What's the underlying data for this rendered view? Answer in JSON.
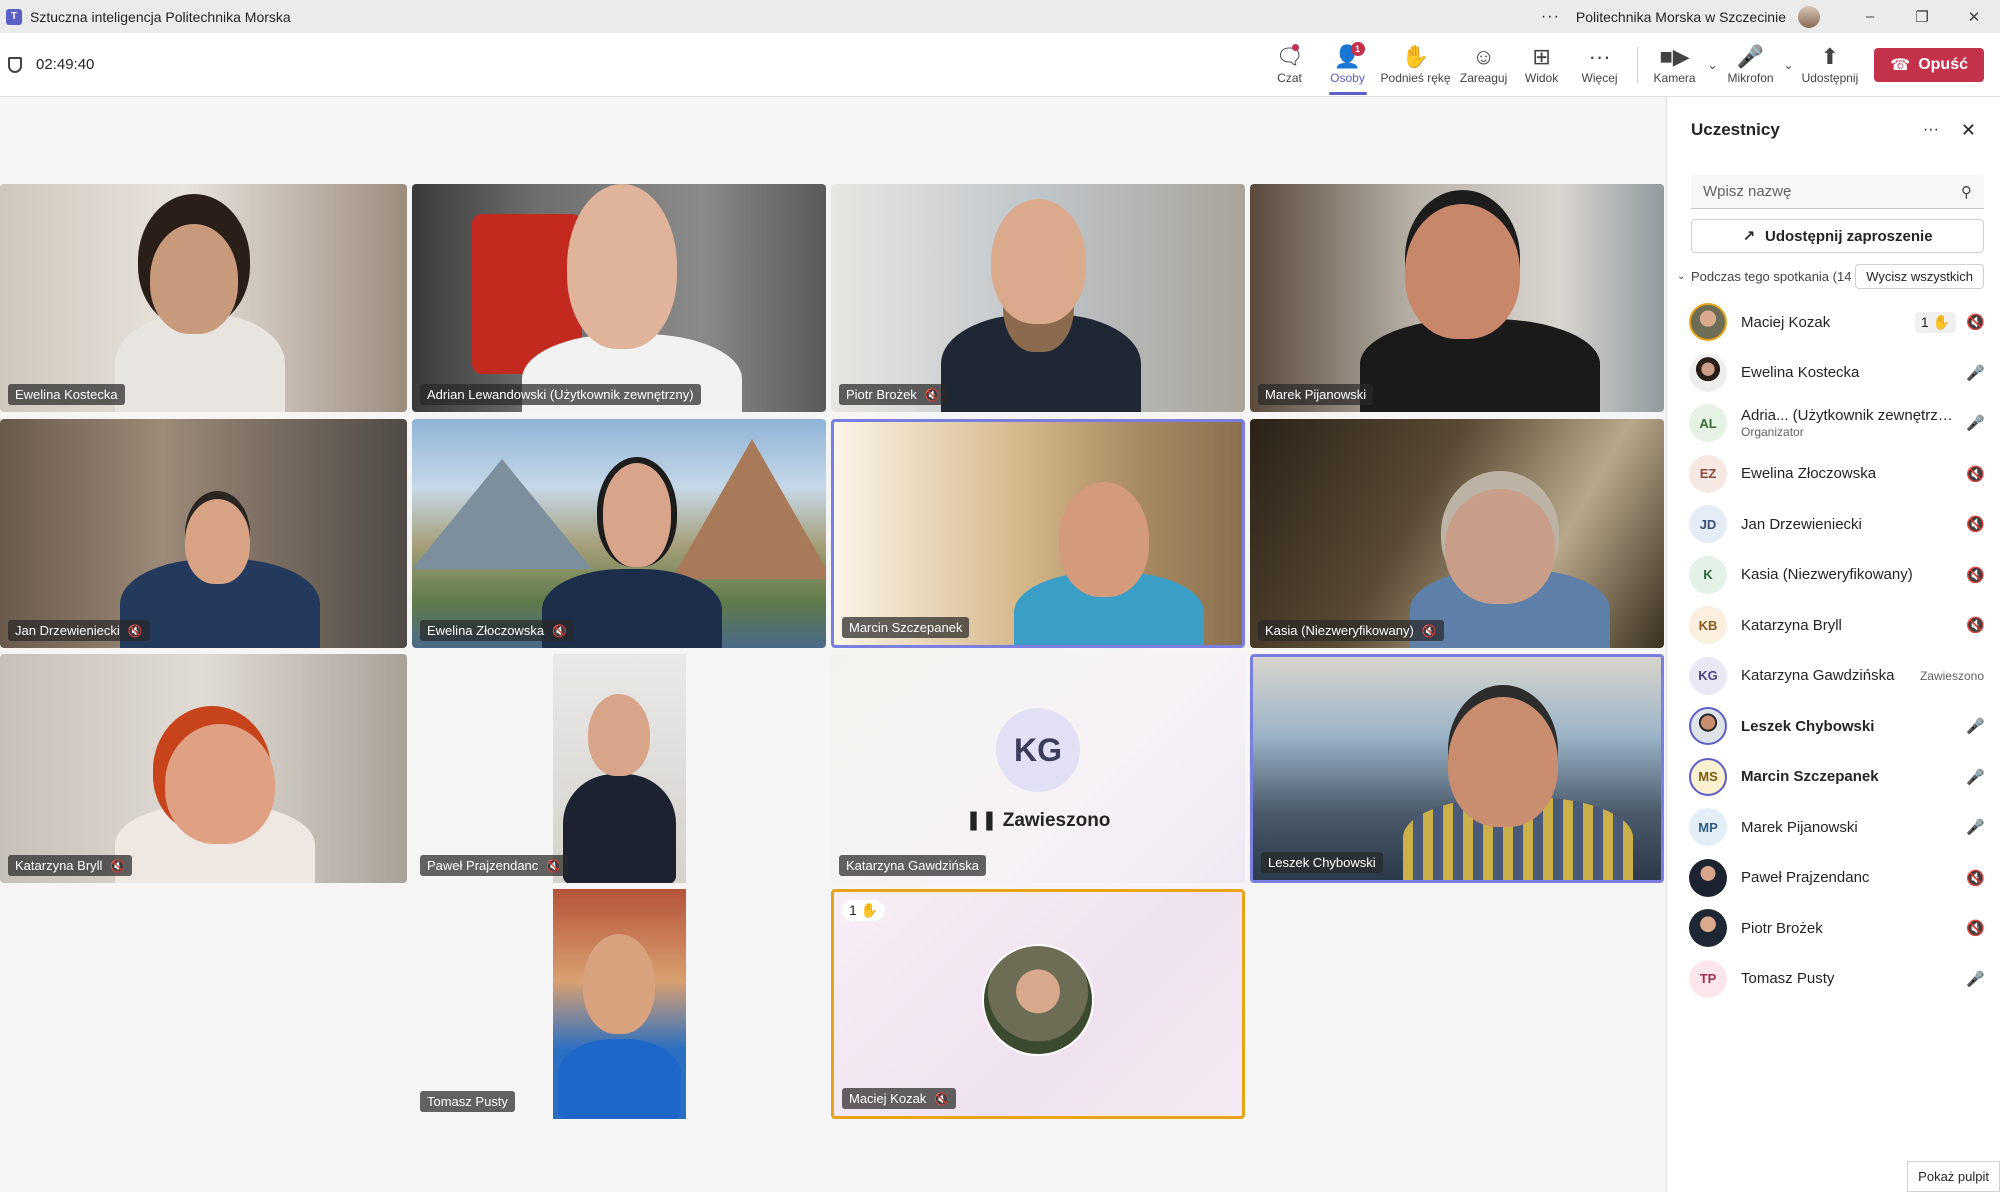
{
  "window": {
    "title": "Sztuczna inteligencja Politechnika Morska",
    "organization": "Politechnika Morska w Szczecinie",
    "more_icon": "more-horizontal-icon"
  },
  "toolbar": {
    "timer": "02:49:40",
    "chat_label": "Czat",
    "people_label": "Osoby",
    "people_badge": "1",
    "raise_hand_label": "Podnieś rękę",
    "react_label": "Zareaguj",
    "view_label": "Widok",
    "more_label": "Więcej",
    "camera_label": "Kamera",
    "mic_label": "Mikrofon",
    "share_label": "Udostępnij",
    "leave_label": "Opuść",
    "leave_color": "#c4314b",
    "accent_color": "#5b5fc7"
  },
  "tiles": {
    "t1": "Ewelina Kostecka",
    "t2": "Adrian Lewandowski (Użytkownik zewnętrzny)",
    "t3": "Piotr Brożek",
    "t4": "Marek Pijanowski",
    "t5": "Jan Drzewieniecki",
    "t6": "Ewelina Złoczowska",
    "t7": "Marcin Szczepanek",
    "t8": "Kasia (Niezweryfikowany)",
    "t9": "Katarzyna Bryll",
    "t10": "Paweł Prajzendanc",
    "t11": "Katarzyna Gawdzińska",
    "t11_initials": "KG",
    "t11_status": "Zawieszono",
    "t12": "Leszek Chybowski",
    "t13": "Tomasz Pusty",
    "t14": "Maciej Kozak",
    "t14_hand_count": "1"
  },
  "panel": {
    "title": "Uczestnicy",
    "search_placeholder": "Wpisz nazwę",
    "share_invite": "Udostępnij zaproszenie",
    "section_label": "Podczas tego spotkania (14",
    "mute_all": "Wycisz wszystkich",
    "participants": [
      {
        "name": "Maciej Kozak",
        "hand": "1",
        "mic": "muted"
      },
      {
        "name": "Ewelina Kostecka",
        "mic": "on"
      },
      {
        "initials": "AL",
        "name": "Adria... (Użytkownik zewnętrzny)",
        "role": "Organizator",
        "mic": "on"
      },
      {
        "initials": "EZ",
        "name": "Ewelina Złoczowska",
        "mic": "muted"
      },
      {
        "initials": "JD",
        "name": "Jan Drzewieniecki",
        "mic": "muted"
      },
      {
        "initials": "K",
        "name": "Kasia (Niezweryfikowany)",
        "mic": "muted"
      },
      {
        "initials": "KB",
        "name": "Katarzyna Bryll",
        "mic": "muted"
      },
      {
        "initials": "KG",
        "name": "Katarzyna Gawdzińska",
        "state": "Zawieszono"
      },
      {
        "name": "Leszek Chybowski",
        "mic": "on"
      },
      {
        "initials": "MS",
        "name": "Marcin Szczepanek",
        "mic": "on"
      },
      {
        "initials": "MP",
        "name": "Marek Pijanowski",
        "mic": "on"
      },
      {
        "name": "Paweł Prajzendanc",
        "mic": "muted"
      },
      {
        "name": "Piotr Brożek",
        "mic": "muted"
      },
      {
        "initials": "TP",
        "name": "Tomasz Pusty",
        "mic": "on"
      }
    ]
  },
  "taskbar": {
    "show_desktop": "Pokaż pulpit"
  }
}
